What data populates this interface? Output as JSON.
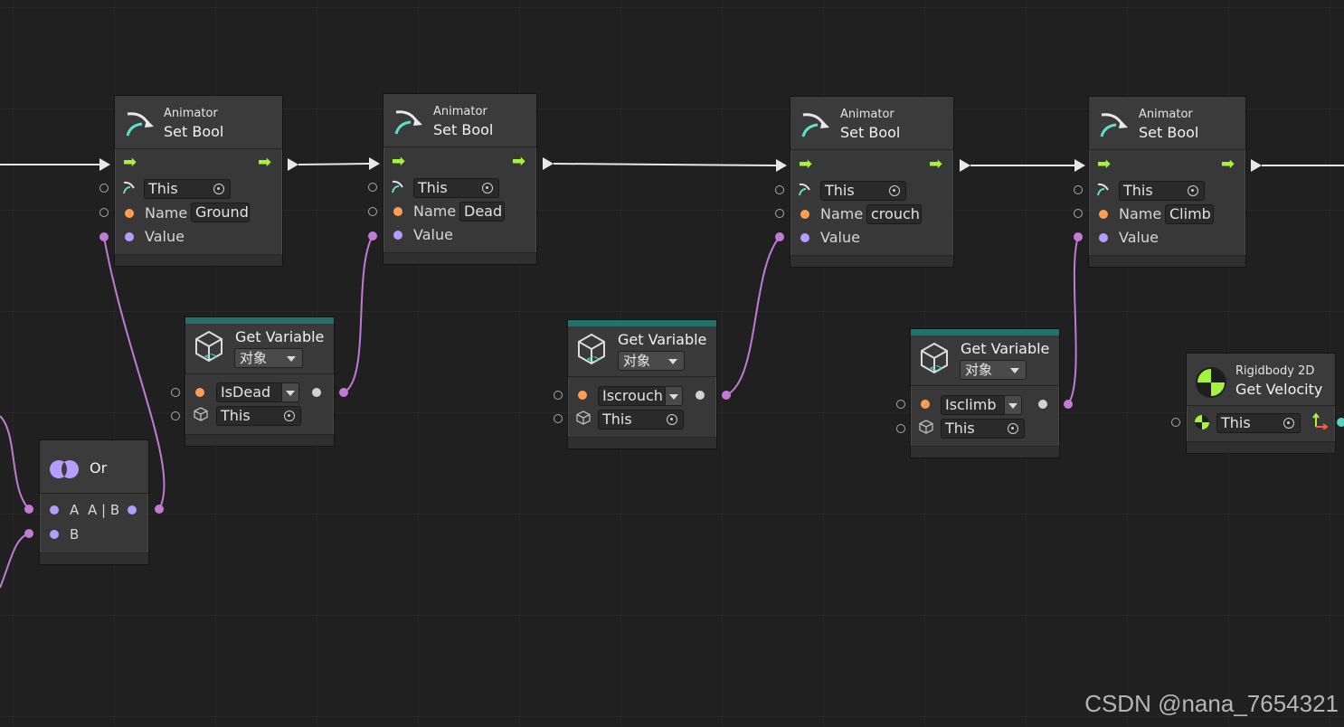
{
  "colors": {
    "background": "#202020",
    "node_body": "#383838",
    "node_header": "#3b3b3b",
    "teal_accent": "#276f6a",
    "port_orange": "#ff9d52",
    "port_purple": "#b69cff",
    "port_magenta": "#c27bd4",
    "flow_green": "#a6f33c",
    "wire_white": "#e8e8e8",
    "wire_magenta": "#c27bd4"
  },
  "set_bool_nodes": [
    {
      "category": "Animator",
      "title": "Set Bool",
      "target": "This",
      "name_label": "Name",
      "name_value": "Ground",
      "value_label": "Value"
    },
    {
      "category": "Animator",
      "title": "Set Bool",
      "target": "This",
      "name_label": "Name",
      "name_value": "Dead",
      "value_label": "Value"
    },
    {
      "category": "Animator",
      "title": "Set Bool",
      "target": "This",
      "name_label": "Name",
      "name_value": "crouch",
      "value_label": "Value"
    },
    {
      "category": "Animator",
      "title": "Set Bool",
      "target": "This",
      "name_label": "Name",
      "name_value": "Climb",
      "value_label": "Value"
    }
  ],
  "get_variable_nodes": [
    {
      "title": "Get Variable",
      "kind": "对象",
      "variable": "IsDead",
      "target": "This"
    },
    {
      "title": "Get Variable",
      "kind": "对象",
      "variable": "Iscrouch",
      "target": "This"
    },
    {
      "title": "Get Variable",
      "kind": "对象",
      "variable": "Isclimb",
      "target": "This"
    }
  ],
  "or_node": {
    "title": "Or",
    "port_a": "A",
    "port_b": "B",
    "output": "A | B"
  },
  "velocity_node": {
    "category": "Rigidbody 2D",
    "title": "Get Velocity",
    "target": "This"
  },
  "watermark": "CSDN @nana_7654321"
}
